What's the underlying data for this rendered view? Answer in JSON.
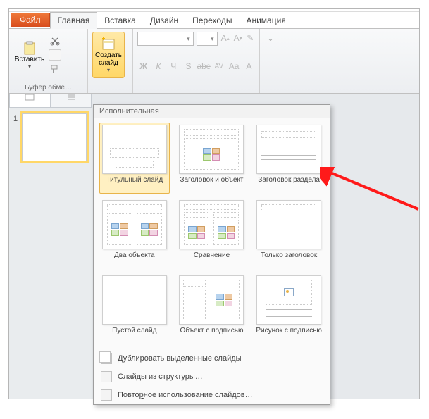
{
  "tabs": {
    "file": "Файл",
    "home": "Главная",
    "insert": "Вставка",
    "design": "Дизайн",
    "transitions": "Переходы",
    "animation": "Анимация"
  },
  "ribbon": {
    "paste_label": "Вставить",
    "new_slide_label": "Создать слайд",
    "clipboard_group": "Буфер обме…"
  },
  "thumbs": {
    "slide_number": "1"
  },
  "gallery": {
    "header": "Исполнительная",
    "layouts": [
      {
        "label": "Титульный слайд"
      },
      {
        "label": "Заголовок и объект"
      },
      {
        "label": "Заголовок раздела"
      },
      {
        "label": "Два объекта"
      },
      {
        "label": "Сравнение"
      },
      {
        "label": "Только заголовок"
      },
      {
        "label": "Пустой слайд"
      },
      {
        "label": "Объект с подписью"
      },
      {
        "label": "Рисунок с подписью"
      }
    ],
    "cmd_duplicate": "Дублировать выделенные слайды",
    "cmd_from_outline_pre": "Слайды ",
    "cmd_from_outline_u": "и",
    "cmd_from_outline_post": "з структуры…",
    "cmd_reuse_pre": "Повто",
    "cmd_reuse_u": "р",
    "cmd_reuse_post": "ное использование слайдов…"
  }
}
